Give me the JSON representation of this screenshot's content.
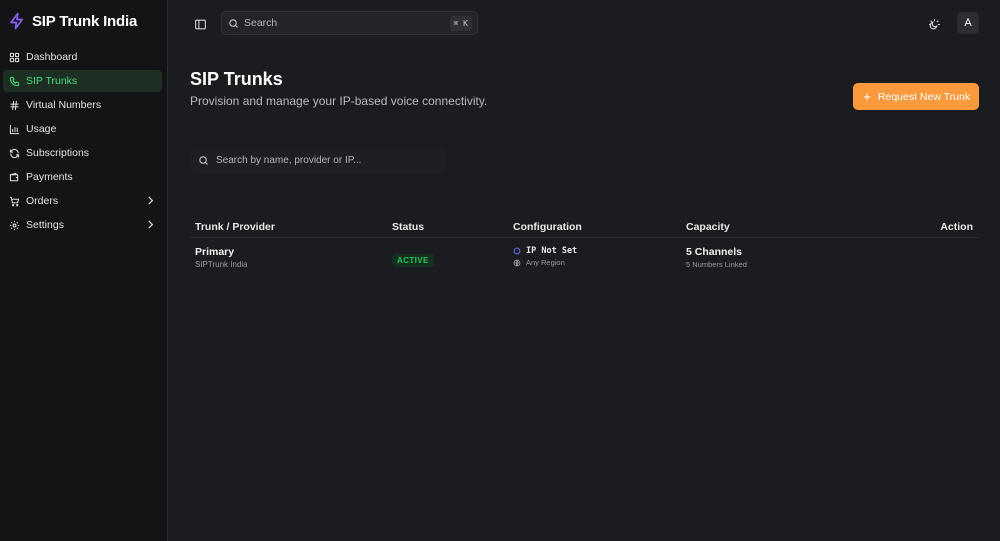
{
  "brand": {
    "name": "SIP Trunk India",
    "accent": "#8b5cf6"
  },
  "sidebar": {
    "items": [
      {
        "label": "Dashboard",
        "icon": "grid-icon",
        "active": false
      },
      {
        "label": "SIP Trunks",
        "icon": "phone-icon",
        "active": true
      },
      {
        "label": "Virtual Numbers",
        "icon": "hash-icon",
        "active": false
      },
      {
        "label": "Usage",
        "icon": "bar-chart-icon",
        "active": false
      },
      {
        "label": "Subscriptions",
        "icon": "refresh-icon",
        "active": false
      },
      {
        "label": "Payments",
        "icon": "wallet-icon",
        "active": false
      },
      {
        "label": "Orders",
        "icon": "cart-icon",
        "active": false,
        "expandable": true
      },
      {
        "label": "Settings",
        "icon": "gear-icon",
        "active": false,
        "expandable": true
      }
    ],
    "active_color": "#4ade80"
  },
  "header": {
    "search_placeholder": "Search",
    "search_shortcut": "⌘ K",
    "avatar_initial": "A"
  },
  "main": {
    "title": "SIP Trunks",
    "subtitle": "Provision and manage your IP-based voice connectivity.",
    "cta_label": "Request New Trunk",
    "cta_color": "#fb9a3c",
    "filter_placeholder": "Search by name, provider or IP...",
    "table": {
      "columns": [
        "Trunk / Provider",
        "Status",
        "Configuration",
        "Capacity",
        "Action"
      ],
      "rows": [
        {
          "name": "Primary",
          "provider": "SIPTrunk India",
          "status": "ACTIVE",
          "ip": "IP Not Set",
          "region": "Any Region",
          "capacity": "5 Channels",
          "linked": "5 Numbers Linked"
        }
      ]
    }
  }
}
